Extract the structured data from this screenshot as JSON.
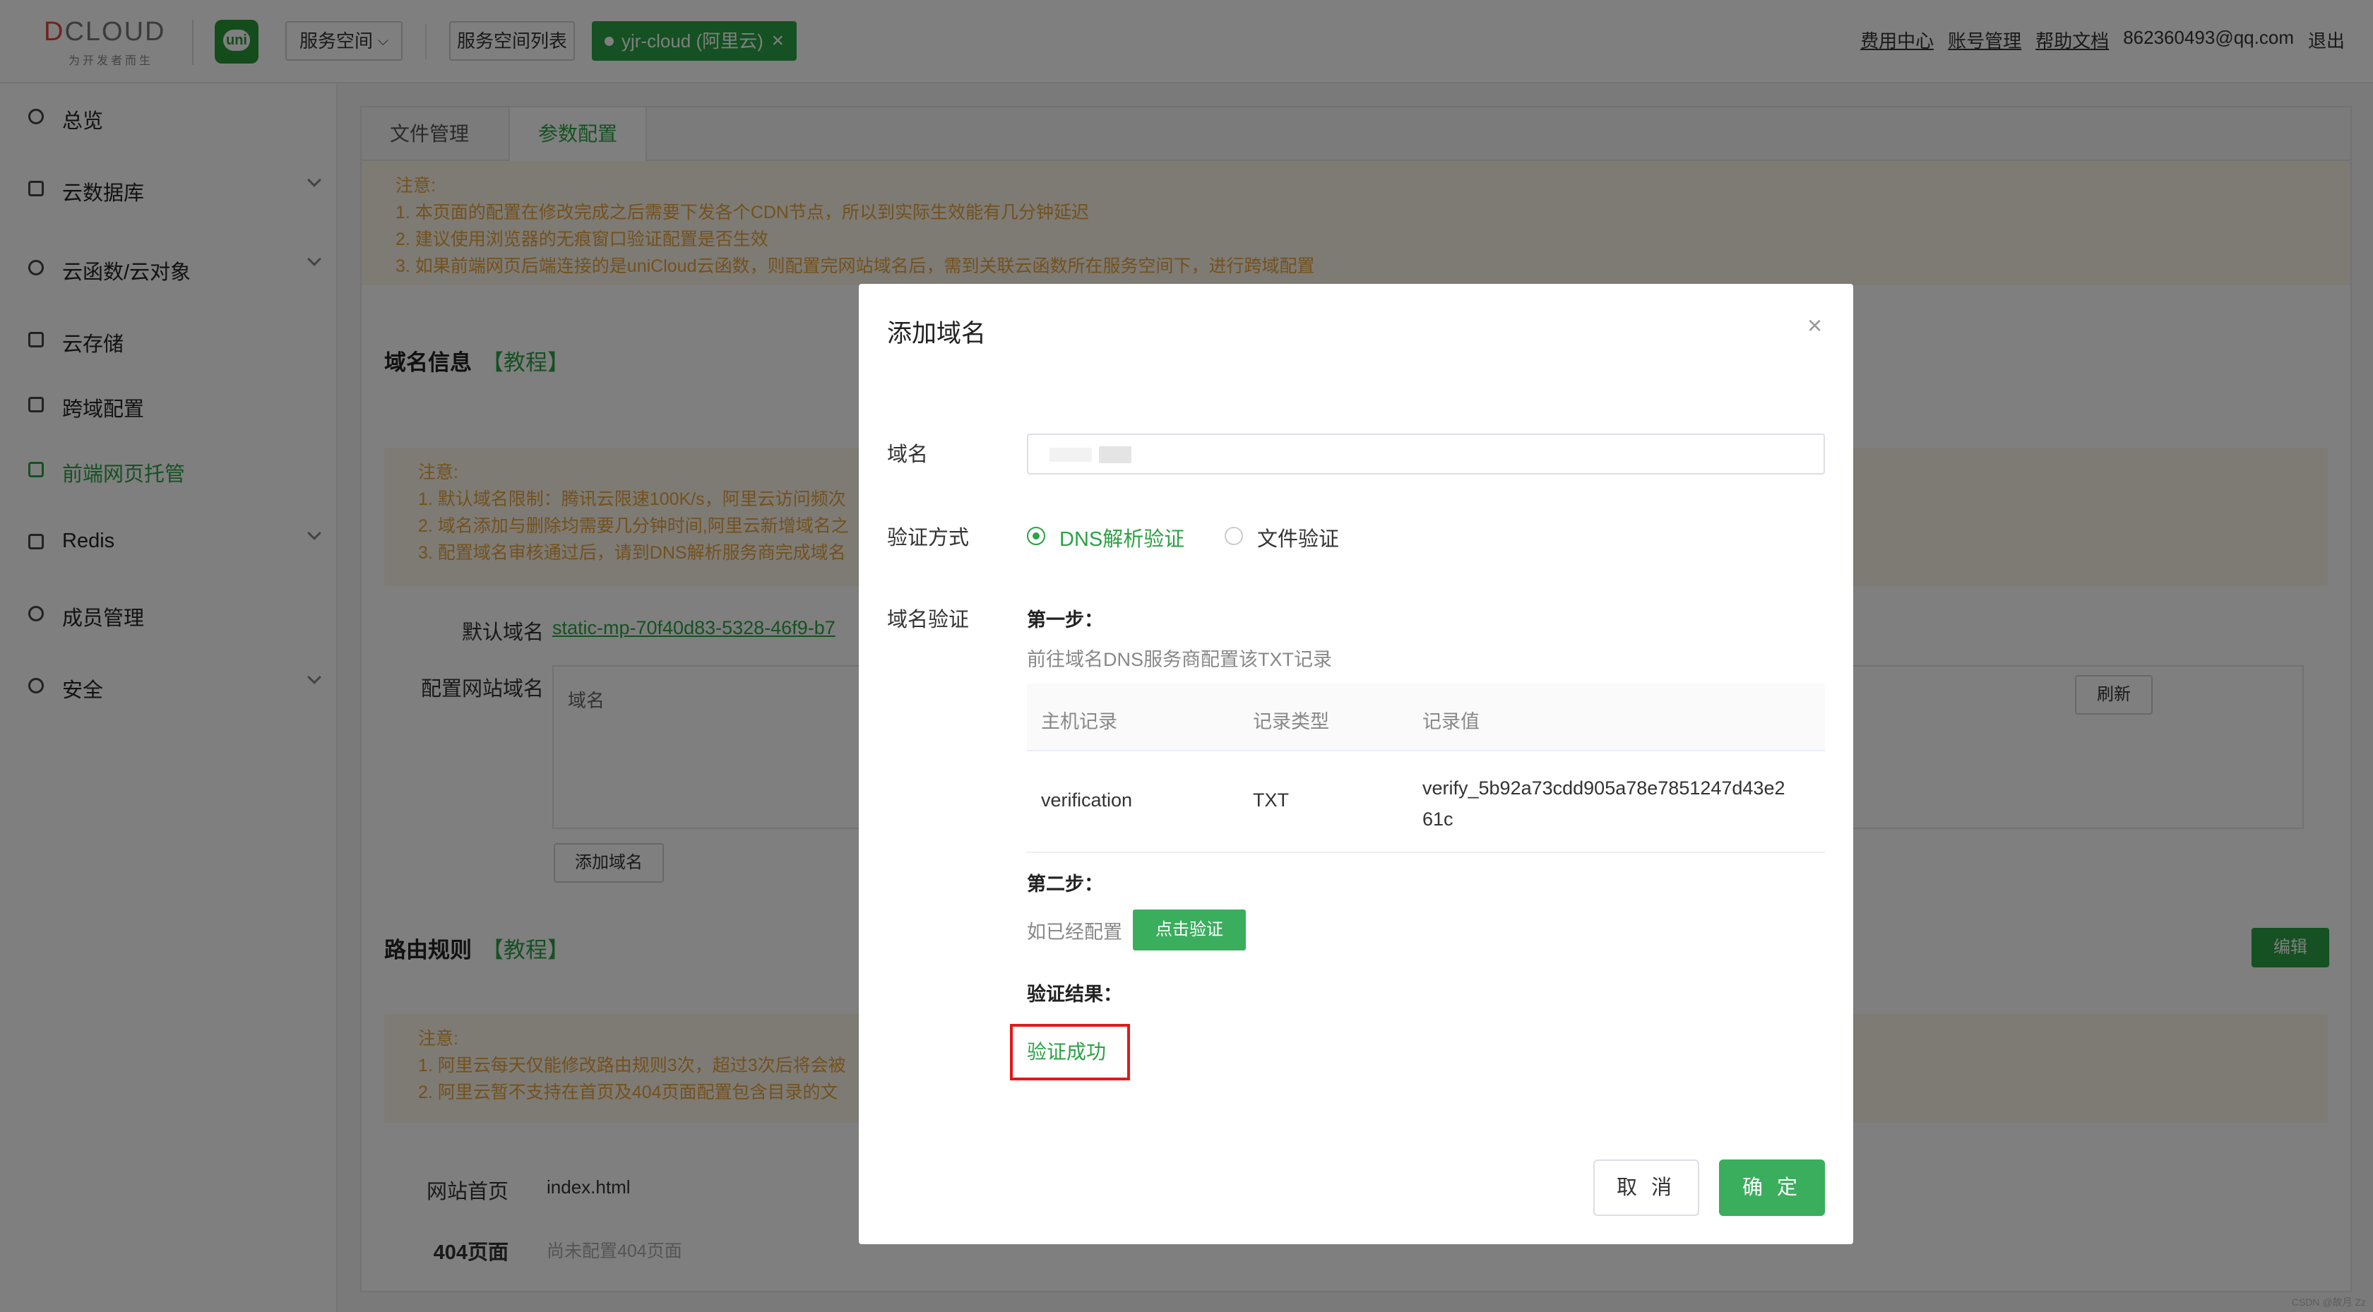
{
  "header": {
    "logo_text_d": "D",
    "logo_text_rest": "CLOUD",
    "logo_sub": "为开发者而生",
    "uni_logo": "uni",
    "space_button": "服务空间",
    "space_list_button": "服务空间列表",
    "cloud_tag": "yjr-cloud (阿里云)",
    "links": [
      "费用中心",
      "账号管理",
      "帮助文档"
    ],
    "user": "862360493@qq.com",
    "logout": "退出"
  },
  "sidebar": {
    "items": [
      {
        "label": "总览",
        "icon": "dashboard-icon"
      },
      {
        "label": "云数据库",
        "icon": "database-icon"
      },
      {
        "label": "云函数/云对象",
        "icon": "cloud-icon"
      },
      {
        "label": "云存储",
        "icon": "storage-icon"
      },
      {
        "label": "跨域配置",
        "icon": "cross-domain-icon"
      },
      {
        "label": "前端网页托管",
        "icon": "hosting-icon"
      },
      {
        "label": "Redis",
        "icon": "redis-icon"
      },
      {
        "label": "成员管理",
        "icon": "member-icon"
      },
      {
        "label": "安全",
        "icon": "shield-icon"
      }
    ]
  },
  "main": {
    "tabs": [
      "文件管理",
      "参数配置"
    ],
    "notice1": [
      "注意:",
      "1. 本页面的配置在修改完成之后需要下发各个CDN节点，所以到实际生效能有几分钟延迟",
      "2. 建议使用浏览器的无痕窗口验证配置是否生效",
      "3. 如果前端网页后端连接的是uniCloud云函数，则配置完网站域名后，需到关联云函数所在服务空间下，进行跨域配置"
    ],
    "domain_title": "域名信息",
    "tutorial": "【教程】",
    "notice2": [
      "注意:",
      "1. 默认域名限制：腾讯云限速100K/s，阿里云访问频次",
      "2. 域名添加与删除均需要几分钟时间,阿里云新增域名之",
      "3. 配置域名审核通过后，请到DNS解析服务商完成域名"
    ],
    "default_domain_label": "默认域名",
    "default_domain_value": "static-mp-70f40d83-5328-46f9-b7",
    "site_domain_label": "配置网站域名",
    "domain_col": "域名",
    "refresh": "刷新",
    "add_domain": "添加域名",
    "route_title": "路由规则",
    "edit": "编辑",
    "notice3": [
      "注意:",
      "1. 阿里云每天仅能修改路由规则3次，超过3次后将会被",
      "2. 阿里云暂不支持在首页及404页面配置包含目录的文"
    ],
    "home_label": "网站首页",
    "home_value": "index.html",
    "page404_label": "404页面",
    "page404_value": "尚未配置404页面"
  },
  "modal": {
    "title": "添加域名",
    "domain_label": "域名",
    "verify_method_label": "验证方式",
    "radio_dns": "DNS解析验证",
    "radio_file": "文件验证",
    "domain_verify_label": "域名验证",
    "step1": "第一步：",
    "step1_hint": "前往域名DNS服务商配置该TXT记录",
    "table_headers": [
      "主机记录",
      "记录类型",
      "记录值"
    ],
    "record": {
      "host": "verification",
      "type": "TXT",
      "value_line1": "verify_5b92a73cdd905a78e7851247d43e2",
      "value_line2": "61c"
    },
    "step2": "第二步：",
    "step2_hint": "如已经配置",
    "verify_button": "点击验证",
    "result_label": "验证结果：",
    "result_value": "验证成功",
    "cancel": "取 消",
    "ok": "确 定"
  },
  "watermark": "CSDN @故月 Zz",
  "colors": {
    "accent": "#2ba245",
    "notice": "#e6a23c",
    "highlight": "#e01a1a"
  }
}
